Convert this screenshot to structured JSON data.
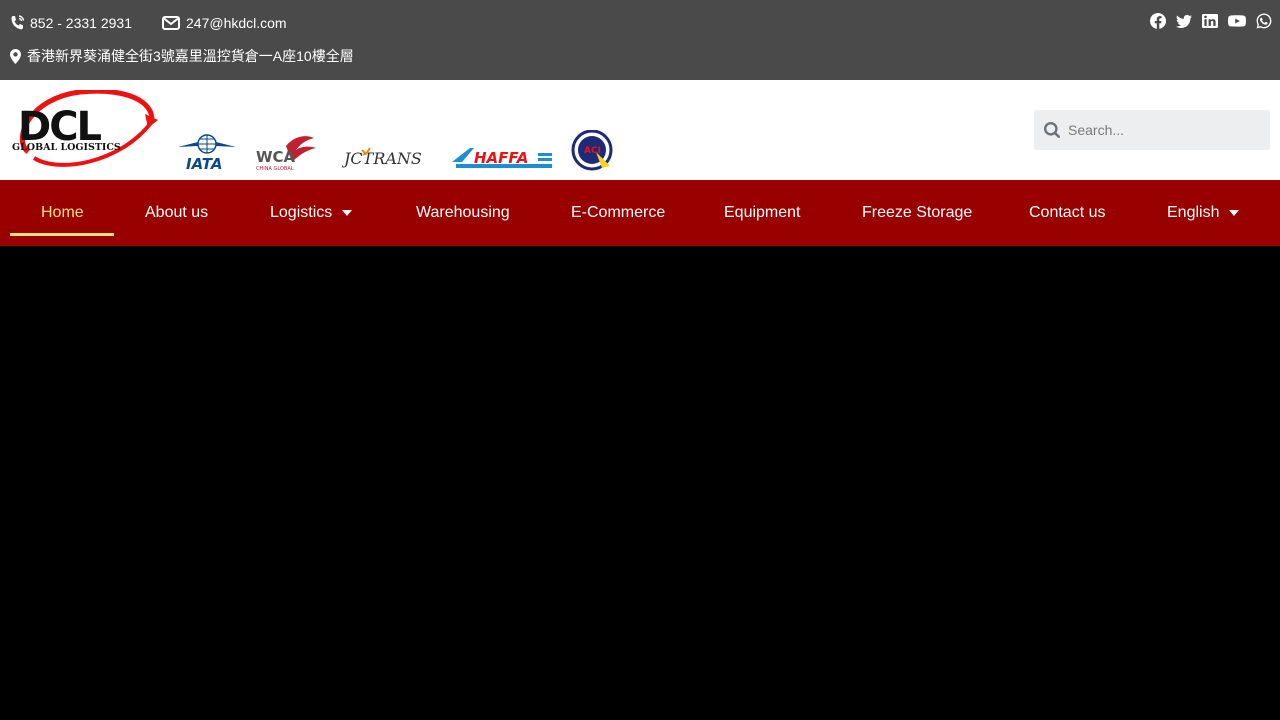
{
  "topbar": {
    "phone": "852 - 2331 2931",
    "email": "247@hkdcl.com",
    "address": "香港新界葵涌健全街3號嘉里溫控貨倉一A座10樓全層",
    "social_icons": [
      "facebook-icon",
      "twitter-icon",
      "linkedin-icon",
      "youtube-icon",
      "whatsapp-icon"
    ]
  },
  "header": {
    "logo_text_main": "DCL",
    "logo_text_sub": "GLOBAL LOGISTICS",
    "partners": {
      "iata": "IATA",
      "wca": "WCA",
      "wca_sub": "CHINA GLOBAL",
      "jctrans": "JCTRANS",
      "haffa": "HAFFA",
      "aci": "ACI"
    },
    "search_placeholder": "Search..."
  },
  "nav": {
    "items": [
      {
        "label": "Home",
        "active": true
      },
      {
        "label": "About us"
      },
      {
        "label": "Logistics",
        "dropdown": true
      },
      {
        "label": "Warehousing"
      },
      {
        "label": "E-Commerce"
      },
      {
        "label": "Equipment"
      },
      {
        "label": "Freeze Storage"
      },
      {
        "label": "Contact us"
      },
      {
        "label": "English",
        "dropdown": true
      }
    ]
  },
  "colors": {
    "topbar_bg": "#4a4a4a",
    "nav_bg": "#990000",
    "active_nav": "#f5e27a",
    "hero_bg": "#000000"
  }
}
